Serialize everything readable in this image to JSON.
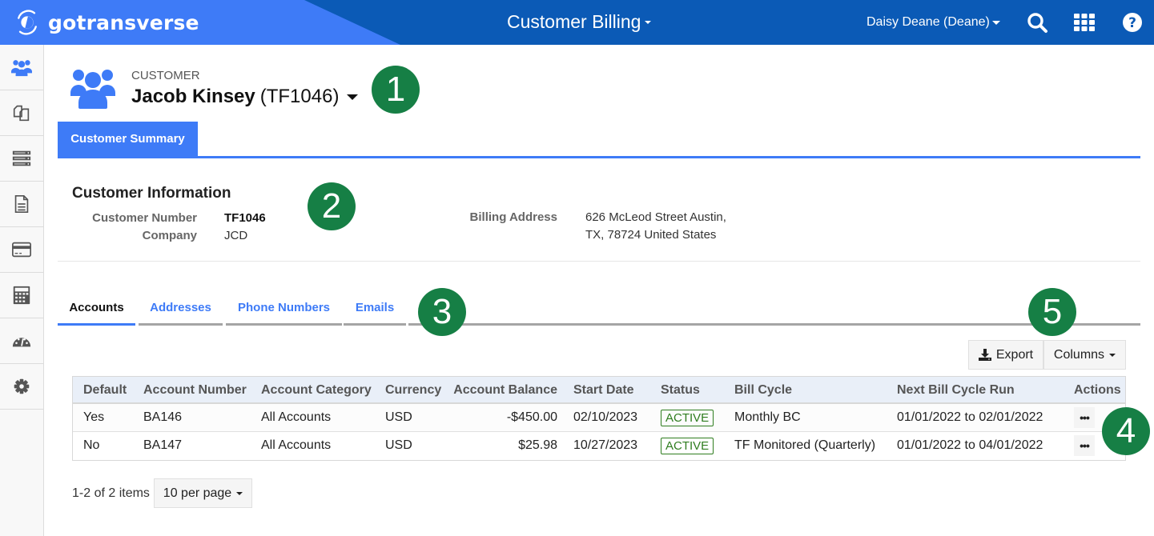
{
  "header": {
    "logo_text": "gotransverse",
    "app_title": "Customer Billing",
    "user": "Daisy Deane (Deane)",
    "icons": [
      "search-icon",
      "apps-grid-icon",
      "help-icon"
    ],
    "brand_color": "#3e7bf7",
    "bar_color": "#0b5ab6"
  },
  "sidebar": {
    "items": [
      {
        "icon": "customers-icon",
        "active": true
      },
      {
        "icon": "documents-icon"
      },
      {
        "icon": "server-list-icon"
      },
      {
        "icon": "file-icon"
      },
      {
        "icon": "credit-card-icon"
      },
      {
        "icon": "calculator-icon"
      },
      {
        "icon": "dashboard-gauge-icon"
      },
      {
        "icon": "settings-gear-icon"
      }
    ]
  },
  "customer": {
    "label": "CUSTOMER",
    "name": "Jacob Kinsey",
    "id": "(TF1046)"
  },
  "primary_tabs": [
    {
      "label": "Customer Summary",
      "active": true
    }
  ],
  "customer_info": {
    "title": "Customer Information",
    "customer_number_label": "Customer Number",
    "customer_number": "TF1046",
    "company_label": "Company",
    "company": "JCD",
    "billing_address_label": "Billing Address",
    "billing_address_line1": "626 McLeod Street Austin,",
    "billing_address_line2": "TX, 78724 United States"
  },
  "sub_tabs": [
    {
      "label": "Accounts",
      "active": true
    },
    {
      "label": "Addresses"
    },
    {
      "label": "Phone Numbers"
    },
    {
      "label": "Emails"
    }
  ],
  "toolbar": {
    "export_label": "Export",
    "columns_label": "Columns"
  },
  "table": {
    "columns": [
      "Default",
      "Account Number",
      "Account Category",
      "Currency",
      "Account Balance",
      "Start Date",
      "Status",
      "Bill Cycle",
      "Next Bill Cycle Run",
      "Actions"
    ],
    "rows": [
      {
        "default": "Yes",
        "account_number": "BA146",
        "category": "All Accounts",
        "currency": "USD",
        "balance": "-$450.00",
        "start_date": "02/10/2023",
        "status": "ACTIVE",
        "bill_cycle": "Monthly BC",
        "next_run": "01/01/2022 to 02/01/2022",
        "actions": "•••"
      },
      {
        "default": "No",
        "account_number": "BA147",
        "category": "All Accounts",
        "currency": "USD",
        "balance": "$25.98",
        "start_date": "10/27/2023",
        "status": "ACTIVE",
        "bill_cycle": "TF Monitored (Quarterly)",
        "next_run": "01/01/2022 to 04/01/2022",
        "actions": "•••"
      }
    ]
  },
  "pagination": {
    "summary": "1-2 of 2 items",
    "per_page": "10 per page"
  },
  "callouts": [
    "1",
    "2",
    "3",
    "4",
    "5"
  ],
  "colors": {
    "callout": "#167f45",
    "status_active": "#2f7d1f",
    "link": "#3e7bf7"
  }
}
